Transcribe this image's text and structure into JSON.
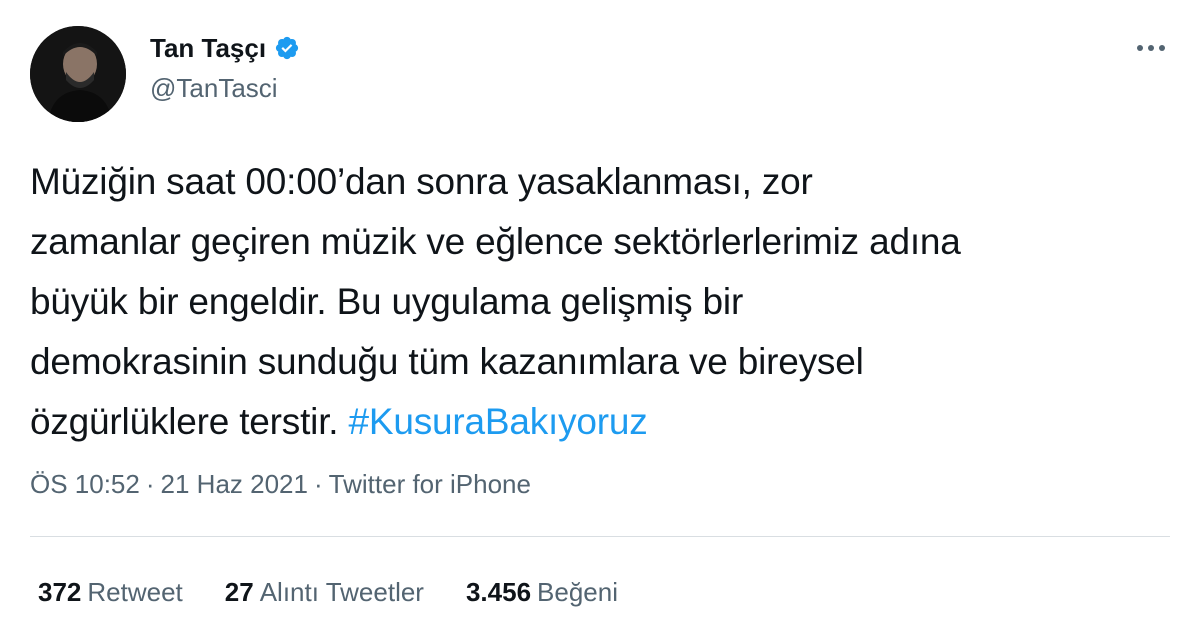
{
  "author": {
    "display_name": "Tan Taşçı",
    "handle": "@TanTasci",
    "verified": true,
    "avatar_icon": "person-avatar-icon"
  },
  "menu": {
    "icon": "more-options-icon"
  },
  "tweet": {
    "lines": [
      "Müziğin saat 00:00’dan sonra yasaklanması, zor",
      "zamanlar geçiren müzik ve eğlence sektörlerlerimiz adına",
      "büyük bir engeldir. Bu uygulama gelişmiş bir",
      "demokrasinin sunduğu tüm kazanımlara ve bireysel",
      "özgürlüklere terstir."
    ],
    "hashtag": "#KusuraBakıyoruz"
  },
  "meta": {
    "time": "ÖS 10:52",
    "date": "21 Haz 2021",
    "separator": "·",
    "source": "Twitter for iPhone"
  },
  "stats": {
    "retweets": {
      "count": "372",
      "label": "Retweet"
    },
    "quotes": {
      "count": "27",
      "label": "Alıntı Tweetler"
    },
    "likes": {
      "count": "3.456",
      "label": "Beğeni"
    }
  },
  "colors": {
    "text": "#0f1419",
    "secondary": "#536471",
    "accent": "#1d9bf0",
    "divider": "#d9dee2"
  }
}
